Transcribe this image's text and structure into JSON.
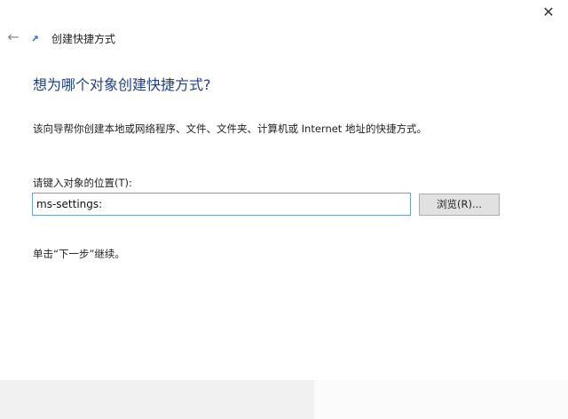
{
  "window": {
    "title": "创建快捷方式",
    "close_icon": "close-icon",
    "back_icon": "back-arrow-icon",
    "app_icon": "shortcut-icon"
  },
  "wizard": {
    "heading": "想为哪个对象创建快捷方式?",
    "description": "该向导帮你创建本地或网络程序、文件、文件夹、计算机或 Internet 地址的快捷方式。",
    "location_label": "请键入对象的位置(T):",
    "location_value": "ms-settings:",
    "browse_label": "浏览(R)...",
    "continue_hint": "单击“下一步”继续。"
  },
  "colors": {
    "heading": "#1f3f8f",
    "input_border": "#6aa1d6",
    "button_bg": "#e1e1e1",
    "footer_bg": "#f1f1f1"
  }
}
